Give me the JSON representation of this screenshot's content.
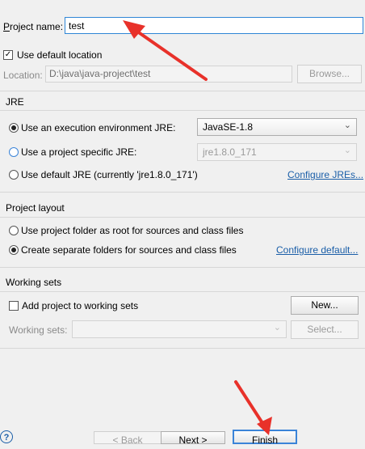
{
  "project": {
    "name_label": "Project name:",
    "name_value": "test",
    "use_default_label": "Use default location",
    "use_default_checked": true,
    "location_label": "Location:",
    "location_value": "D:\\java\\java-project\\test",
    "browse_label": "Browse..."
  },
  "jre": {
    "title": "JRE",
    "option1_label": "Use an execution environment JRE:",
    "option1_value": "JavaSE-1.8",
    "option2_label": "Use a project specific JRE:",
    "option2_value": "jre1.8.0_171",
    "option3_label": "Use default JRE (currently 'jre1.8.0_171')",
    "configure_link": "Configure JREs..."
  },
  "layout": {
    "title": "Project layout",
    "option1_label": "Use project folder as root for sources and class files",
    "option2_label": "Create separate folders for sources and class files",
    "configure_link": "Configure default..."
  },
  "working_sets": {
    "title": "Working sets",
    "add_label": "Add project to working sets",
    "new_label": "New...",
    "sets_label": "Working sets:",
    "select_label": "Select..."
  },
  "footer": {
    "help": "?",
    "back_label": "< Back",
    "next_label": "Next >",
    "finish_label": "Finish"
  },
  "colors": {
    "arrow": "#e8312a",
    "link": "#1a5ea8",
    "focus": "#3b84d8"
  }
}
